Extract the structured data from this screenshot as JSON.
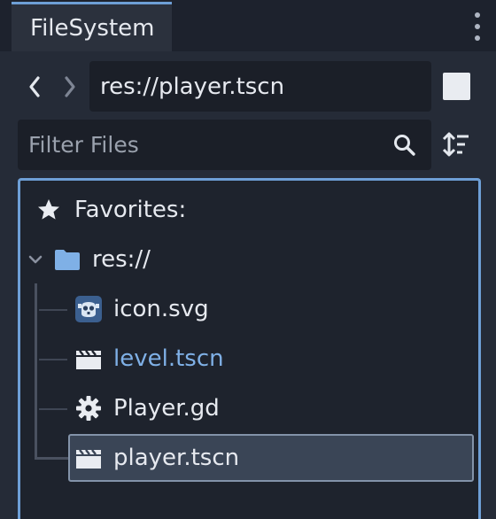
{
  "tabs": [
    {
      "label": "FileSystem",
      "active": true
    }
  ],
  "path": {
    "value": "res://player.tscn"
  },
  "filter": {
    "placeholder": "Filter Files",
    "value": ""
  },
  "tree": {
    "favorites_label": "Favorites:",
    "root_label": "res://",
    "items": [
      {
        "label": "icon.svg",
        "icon": "godot-image-icon"
      },
      {
        "label": "level.tscn",
        "icon": "scene-clapper-icon",
        "highlighted": true
      },
      {
        "label": "Player.gd",
        "icon": "gear-script-icon"
      },
      {
        "label": "player.tscn",
        "icon": "scene-clapper-icon",
        "selected": true
      }
    ]
  },
  "colors": {
    "accent": "#6e9fd6",
    "panel_bg": "#252b37",
    "field_bg": "#1b1f28",
    "selection_bg": "#3a4556",
    "link_text": "#7fb0e6",
    "folder": "#7fb0e6"
  }
}
